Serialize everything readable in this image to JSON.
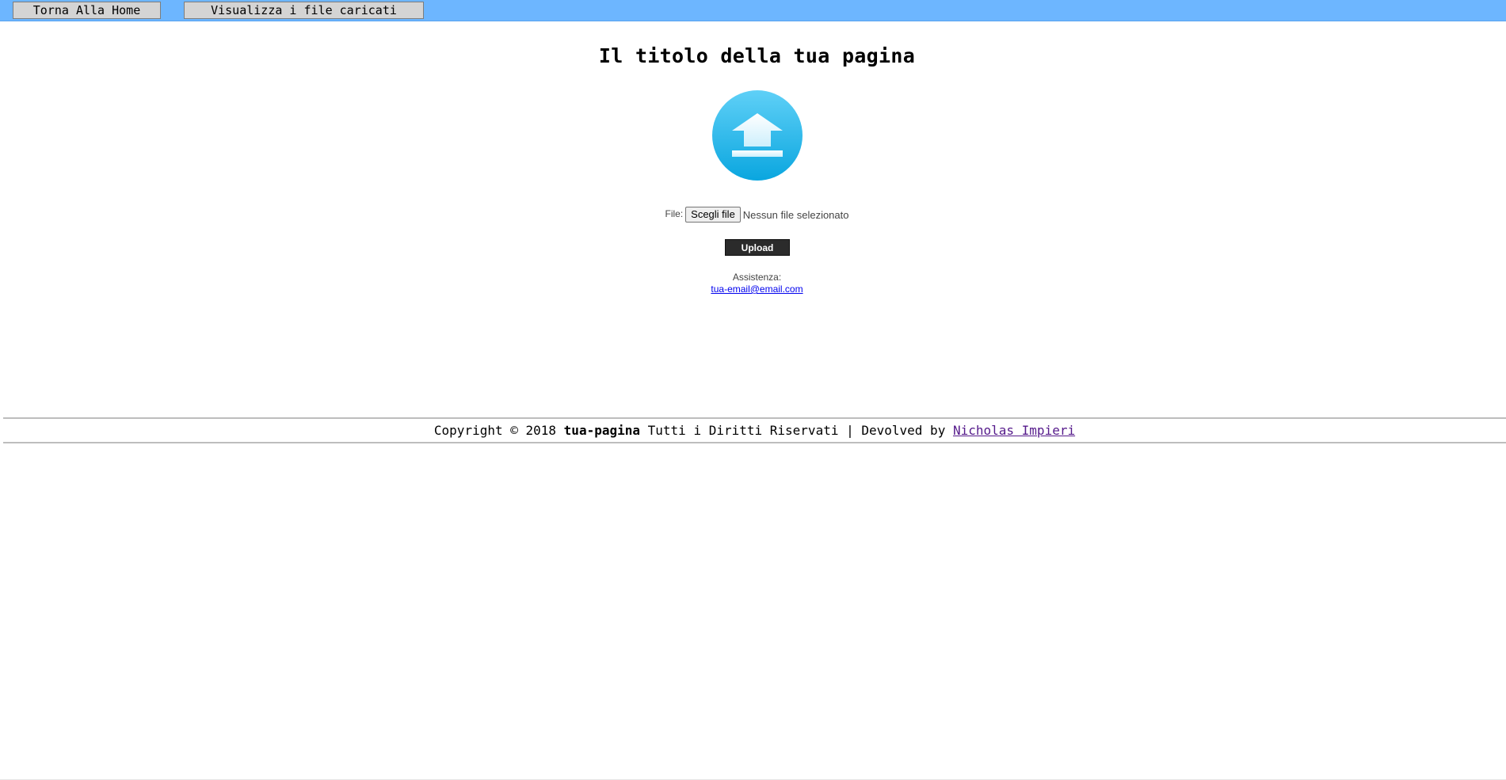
{
  "nav": {
    "home_label": "Torna Alla Home",
    "files_label": "Visualizza i file caricati"
  },
  "page": {
    "title": "Il titolo della tua pagina"
  },
  "upload_form": {
    "icon": "upload-arrow-icon",
    "file_label": "File:",
    "choose_button_label": "Scegli file",
    "file_status": "Nessun file selezionato",
    "upload_button_label": "Upload"
  },
  "support": {
    "label": "Assistenza:",
    "email": "tua-email@email.com"
  },
  "footer": {
    "copyright_prefix": "Copyright © 2018",
    "site_name": "tua-pagina",
    "rights_text": "Tutti i Diritti Riservati | Devolved by",
    "author_link": "Nicholas Impieri"
  },
  "colors": {
    "topbar": "#6db6ff",
    "upload_circle": "#2bb8ee",
    "upload_button": "#2b2b2b"
  }
}
